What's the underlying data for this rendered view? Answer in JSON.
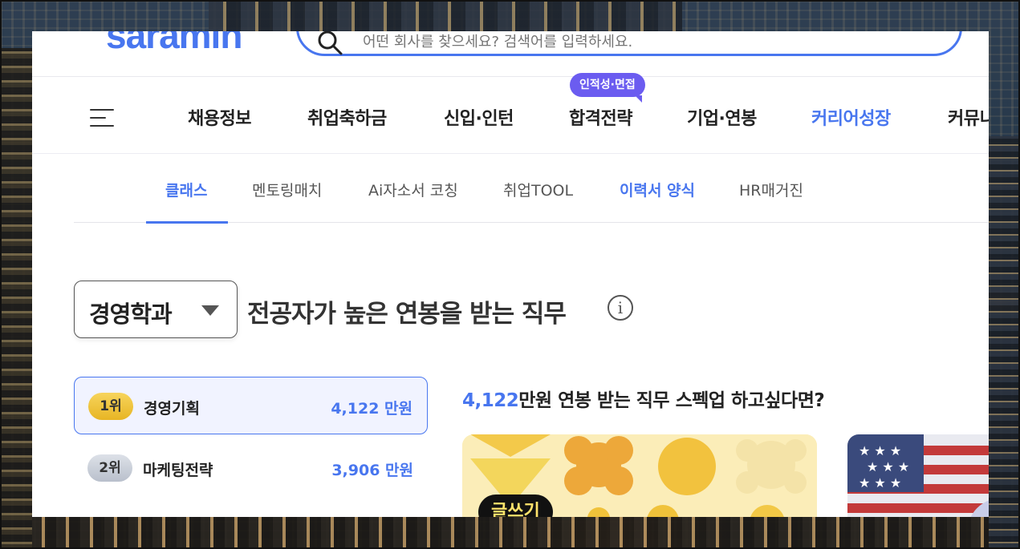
{
  "header": {
    "logo_text": "saramin",
    "search_placeholder": "어떤 회사를 찾으세요? 검색어를 입력하세요."
  },
  "gnb": {
    "menu_icon": "hamburger-menu-icon",
    "items": [
      {
        "label": "채용정보"
      },
      {
        "label": "취업축하금"
      },
      {
        "label": "신입·인턴"
      },
      {
        "label": "합격전략"
      },
      {
        "label": "기업·연봉"
      },
      {
        "label": "커리어성장"
      },
      {
        "label": "커뮤니"
      }
    ],
    "badge": "인적성·면접",
    "accent_color": "#4876ef",
    "badge_color": "#6b5cf0"
  },
  "subnav": {
    "tabs": [
      {
        "label": "클래스"
      },
      {
        "label": "멘토링매치"
      },
      {
        "label": "Ai자소서 코칭"
      },
      {
        "label": "취업TOOL"
      },
      {
        "label": "이력서 양식"
      },
      {
        "label": "HR매거진"
      }
    ],
    "active_tab": "클래스"
  },
  "section": {
    "major_selected": "경영학과",
    "title": "전공자가 높은 연봉을 받는 직무",
    "info_icon": "info-icon"
  },
  "ranking": [
    {
      "rank": "1위",
      "job": "경영기획",
      "salary": "4,122 만원"
    },
    {
      "rank": "2위",
      "job": "마케팅전략",
      "salary": "3,906 만원"
    }
  ],
  "promo": {
    "highlight": "4,122",
    "title_rest": "만원 연봉 받는 직무 스펙업 하고싶다면?",
    "card_tag": "글쓰기"
  }
}
